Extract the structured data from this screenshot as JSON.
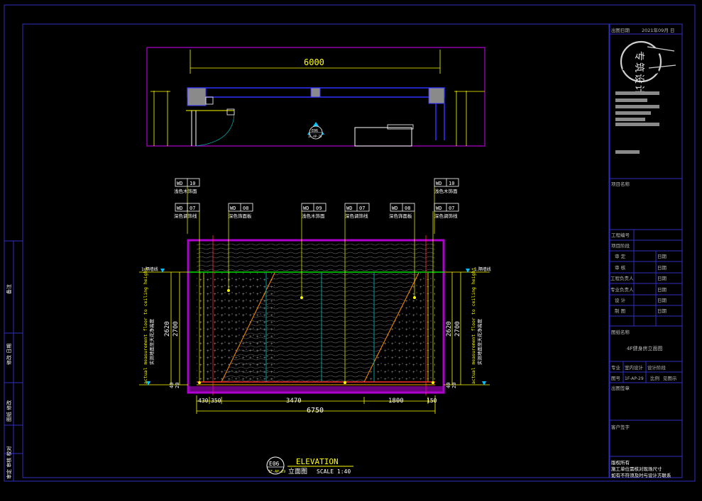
{
  "plan": {
    "width_dim": "6000",
    "symbol_top": "E06",
    "symbol_bottom": "1F-AP-29"
  },
  "tags": {
    "t1_code": "WD",
    "t1_num": "10",
    "t1_text": "浅色木饰面",
    "t2_code": "WD",
    "t2_num": "07",
    "t2_text": "深色调饰线",
    "t3_code": "WD",
    "t3_num": "08",
    "t3_text": "深色饰面板",
    "t4_code": "WD",
    "t4_num": "09",
    "t4_text": "浅色木饰面",
    "t5_code": "WD",
    "t5_num": "07",
    "t5_text": "深色调饰线",
    "t6_code": "WD",
    "t6_num": "08",
    "t6_text": "深色饰面板",
    "t7_code": "WD",
    "t7_num": "10",
    "t7_text": "浅色木饰面",
    "t8_code": "WD",
    "t8_num": "07",
    "t8_text": "深色调饰线"
  },
  "elevation": {
    "level_tag": "1.隔墙线",
    "height_left_a": "2620",
    "height_left_b": "2700",
    "height_right_a": "2620",
    "height_right_b": "2700",
    "side_note_en": "actual measurement floor to ceiling height",
    "side_note_cn": "实测地面至天花净高度",
    "base_left_a": "40",
    "base_left_b": "20",
    "base_right_a": "40",
    "base_right_b": "20",
    "dims": {
      "d1": "430",
      "d2": "350",
      "d3": "3470",
      "d4": "1800",
      "d5": "150",
      "total": "6750"
    }
  },
  "title": {
    "code": "E06",
    "sheet": "1F-AP-29",
    "name": "ELEVATION",
    "cn": "立面图",
    "scale": "SCALE 1:40"
  },
  "left_strip": {
    "l1": "备注",
    "l2": "修改 日期",
    "l3": "图纸 修改",
    "l4": "审定 审核 校对"
  },
  "title_block": {
    "date_label": "出图日期",
    "date_value": "2021年09月 日",
    "logo_text": "专筑设计",
    "project_name_label": "项目名称",
    "project_number_label": "工程编号",
    "project_phase_label": "项目阶段",
    "roles": [
      {
        "role": "审 定",
        "sig": "日期"
      },
      {
        "role": "审 核",
        "sig": "日期"
      },
      {
        "role": "工程负责人",
        "sig": "日期"
      },
      {
        "role": "专业负责人",
        "sig": "日期"
      },
      {
        "role": "设 计",
        "sig": "日期"
      },
      {
        "role": "制 图",
        "sig": "日期"
      }
    ],
    "drawing_name_label": "图纸名称",
    "drawing_name_value": "4F健身房立面图",
    "spec_label": "专业",
    "spec_value": "室内设计",
    "design_stage": "设计阶段",
    "sheet_label": "图号",
    "sheet_value": "1F-AP-29",
    "scale_label": "比例",
    "scale_value": "见图示",
    "stamp_label": "出图签章",
    "client_label": "客户签字",
    "notes": [
      "版权所有",
      "施工单位需核对现场尺寸",
      "如有不符须及时与设计方联系"
    ]
  },
  "colors": {
    "frame": "#3030c0",
    "magenta": "#b000d0",
    "yellow": "#ffff00",
    "cyan": "#00ffff",
    "green": "#00e000",
    "wall": "#ffffff"
  }
}
